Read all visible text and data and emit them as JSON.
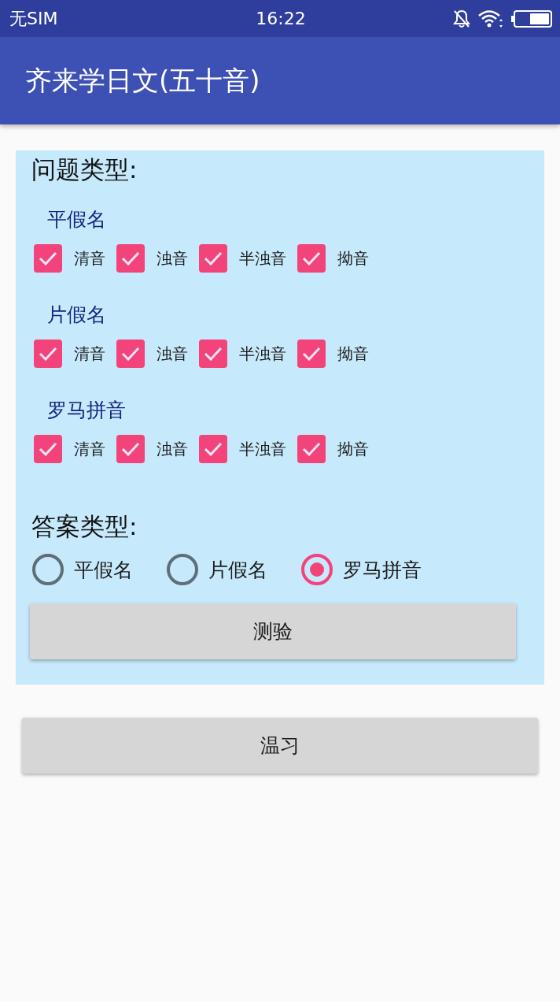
{
  "status_bar": {
    "carrier": "无SIM",
    "time": "16:22"
  },
  "app_bar": {
    "title": "齐来学日文(五十音)"
  },
  "question_type": {
    "heading": "问题类型:",
    "groups": [
      {
        "label": "平假名",
        "options": [
          {
            "label": "清音",
            "checked": true
          },
          {
            "label": "浊音",
            "checked": true
          },
          {
            "label": "半浊音",
            "checked": true
          },
          {
            "label": "拗音",
            "checked": true
          }
        ]
      },
      {
        "label": "片假名",
        "options": [
          {
            "label": "清音",
            "checked": true
          },
          {
            "label": "浊音",
            "checked": true
          },
          {
            "label": "半浊音",
            "checked": true
          },
          {
            "label": "拗音",
            "checked": true
          }
        ]
      },
      {
        "label": "罗马拼音",
        "options": [
          {
            "label": "清音",
            "checked": true
          },
          {
            "label": "浊音",
            "checked": true
          },
          {
            "label": "半浊音",
            "checked": true
          },
          {
            "label": "拗音",
            "checked": true
          }
        ]
      }
    ]
  },
  "answer_type": {
    "heading": "答案类型:",
    "options": [
      {
        "label": "平假名",
        "selected": false
      },
      {
        "label": "片假名",
        "selected": false
      },
      {
        "label": "罗马拼音",
        "selected": true
      }
    ]
  },
  "quiz_button": {
    "label": "测验"
  },
  "review_button": {
    "label": "温习"
  }
}
